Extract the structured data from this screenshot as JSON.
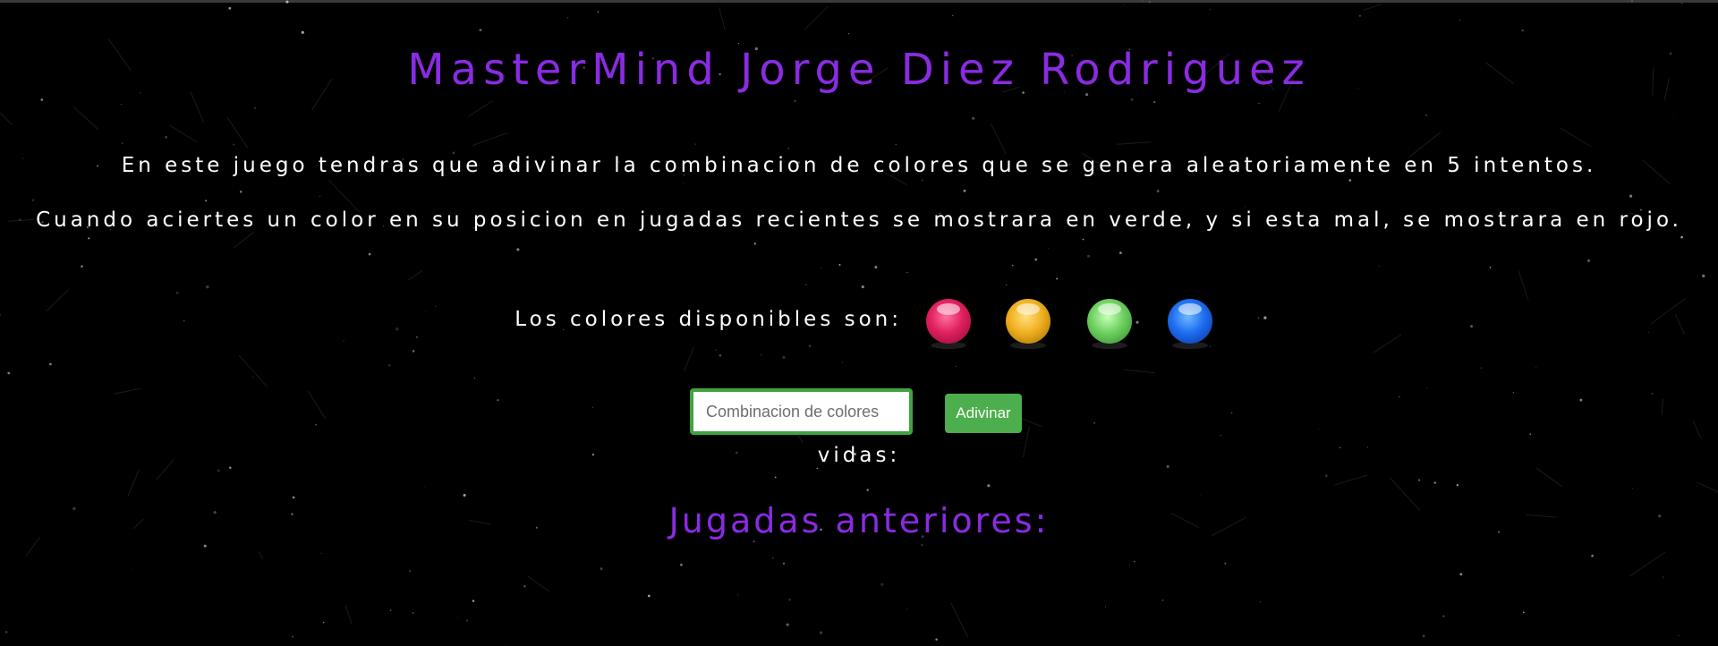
{
  "game": {
    "title": "MasterMind Jorge Diez Rodriguez",
    "intro": "En este juego tendras que adivinar la combinacion de colores que se genera aleatoriamente en 5 intentos.",
    "hint": "Cuando aciertes un color en su posicion en jugadas recientes se mostrara en verde, y si esta mal, se mostrara en rojo.",
    "available_colors_label": "Los colores disponibles son:",
    "available_colors": [
      {
        "name": "pink-ball-icon",
        "color": "#e0205e"
      },
      {
        "name": "yellow-ball-icon",
        "color": "#f0b020"
      },
      {
        "name": "green-ball-icon",
        "color": "#6ed060"
      },
      {
        "name": "blue-ball-icon",
        "color": "#1e6ef0"
      }
    ]
  },
  "form": {
    "input_placeholder": "Combinacion de colores",
    "input_value": "",
    "submit_label": "Adivinar",
    "lives_label": "vidas:"
  },
  "history": {
    "title": "Jugadas anteriores:"
  },
  "theme": {
    "accent": "#8a2be2",
    "button": "#4cae4c",
    "background": "#000000"
  }
}
